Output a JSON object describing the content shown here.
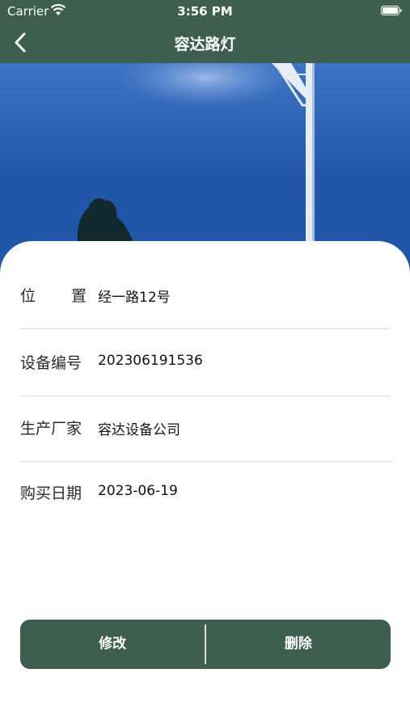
{
  "status_bar": {
    "carrier": "Carrier",
    "time": "3:56 PM"
  },
  "nav": {
    "title": "容达路灯",
    "back_icon": "chevron-left-icon"
  },
  "colors": {
    "primary": "#3e5f4f",
    "sky": "#2257a8",
    "divider": "#d6d6d6"
  },
  "details": {
    "location": {
      "label_chars": [
        "位",
        "置"
      ],
      "value": "经一路12号"
    },
    "device_number": {
      "label": "设备编号",
      "value": "202306191536"
    },
    "manufacturer": {
      "label": "生产厂家",
      "value": "容达设备公司"
    },
    "purchase_date": {
      "label": "购买日期",
      "value": "2023-06-19"
    }
  },
  "actions": {
    "edit_label": "修改",
    "delete_label": "删除"
  }
}
